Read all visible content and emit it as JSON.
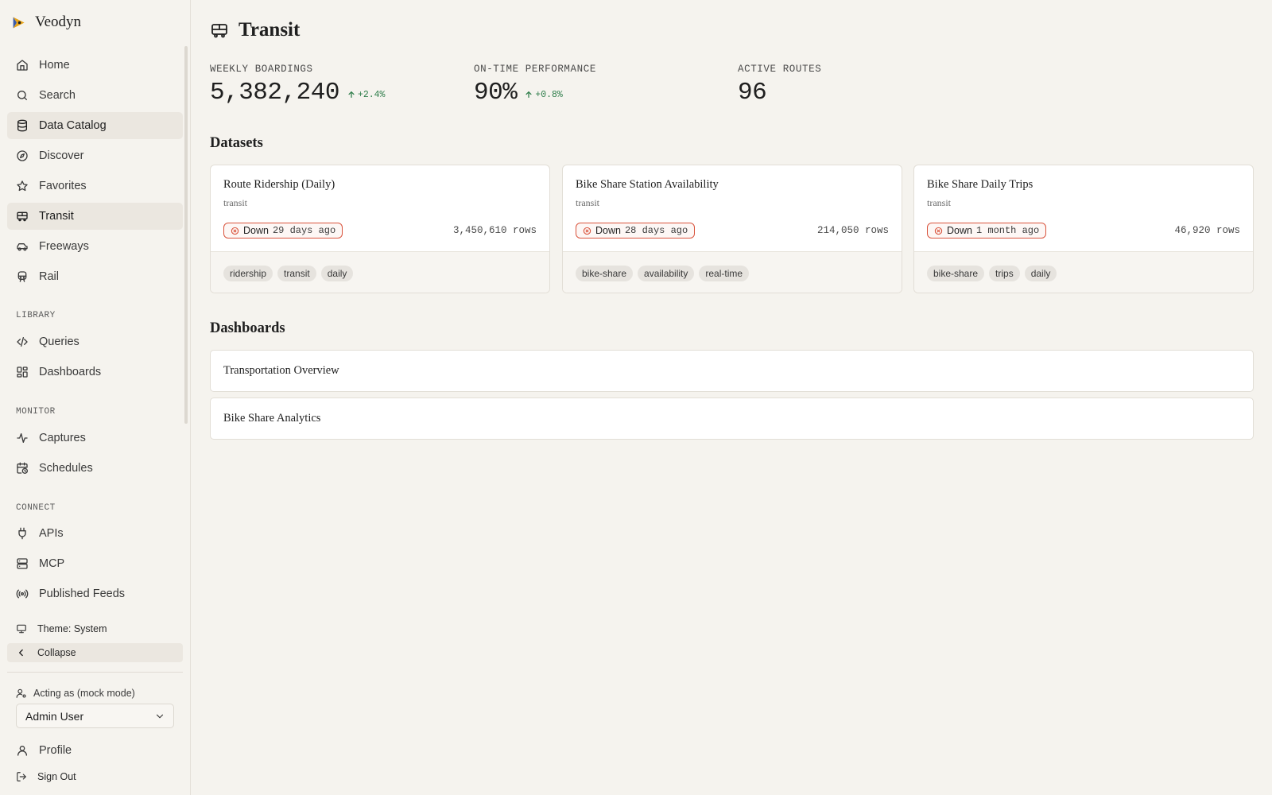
{
  "app": {
    "name": "Veodyn"
  },
  "sidebar": {
    "items": [
      {
        "label": "Home",
        "icon": "home-icon"
      },
      {
        "label": "Search",
        "icon": "search-icon"
      },
      {
        "label": "Data Catalog",
        "icon": "database-icon",
        "active": true
      },
      {
        "label": "Discover",
        "icon": "compass-icon"
      },
      {
        "label": "Favorites",
        "icon": "star-icon"
      },
      {
        "label": "Transit",
        "icon": "bus-icon",
        "active": true
      },
      {
        "label": "Freeways",
        "icon": "car-icon"
      },
      {
        "label": "Rail",
        "icon": "train-icon"
      }
    ],
    "sections": {
      "library": "LIBRARY",
      "monitor": "MONITOR",
      "connect": "CONNECT"
    },
    "library_items": [
      {
        "label": "Queries",
        "icon": "code-icon"
      },
      {
        "label": "Dashboards",
        "icon": "layout-grid-icon"
      }
    ],
    "monitor_items": [
      {
        "label": "Captures",
        "icon": "activity-icon"
      },
      {
        "label": "Schedules",
        "icon": "calendar-clock-icon"
      }
    ],
    "connect_items": [
      {
        "label": "APIs",
        "icon": "plug-icon"
      },
      {
        "label": "MCP",
        "icon": "server-icon"
      },
      {
        "label": "Published Feeds",
        "icon": "radio-icon"
      }
    ],
    "theme_label": "Theme: System",
    "collapse_label": "Collapse",
    "acting_as_label": "Acting as (mock mode)",
    "acting_as_value": "Admin User",
    "profile_label": "Profile",
    "signout_label": "Sign Out"
  },
  "page": {
    "title": "Transit",
    "icon": "bus-icon",
    "kpis": [
      {
        "label": "WEEKLY BOARDINGS",
        "value": "5,382,240",
        "delta": "+2.4%"
      },
      {
        "label": "ON-TIME PERFORMANCE",
        "value": "90%",
        "delta": "+0.8%"
      },
      {
        "label": "ACTIVE ROUTES",
        "value": "96",
        "delta": ""
      }
    ],
    "datasets_title": "Datasets",
    "datasets": [
      {
        "title": "Route Ridership (Daily)",
        "category": "transit",
        "status": "Down",
        "ago": "29 days ago",
        "rows": "3,450,610 rows",
        "tags": [
          "ridership",
          "transit",
          "daily"
        ]
      },
      {
        "title": "Bike Share Station Availability",
        "category": "transit",
        "status": "Down",
        "ago": "28 days ago",
        "rows": "214,050 rows",
        "tags": [
          "bike-share",
          "availability",
          "real-time"
        ]
      },
      {
        "title": "Bike Share Daily Trips",
        "category": "transit",
        "status": "Down",
        "ago": "1 month ago",
        "rows": "46,920 rows",
        "tags": [
          "bike-share",
          "trips",
          "daily"
        ]
      }
    ],
    "dashboards_title": "Dashboards",
    "dashboards": [
      {
        "title": "Transportation Overview"
      },
      {
        "title": "Bike Share Analytics"
      }
    ]
  },
  "colors": {
    "background": "#f5f3ee",
    "active_nav": "#ebe7e0",
    "delta_positive": "#2e7d4a",
    "status_down": "#d9533c",
    "brand_logo": "#e8a317"
  }
}
